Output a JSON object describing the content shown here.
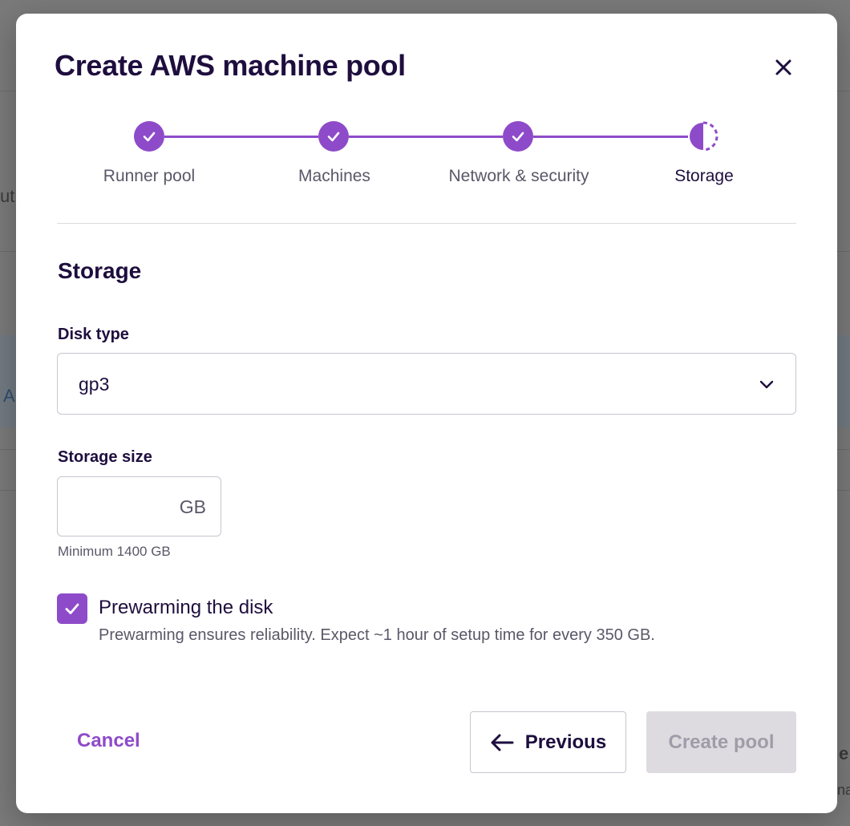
{
  "modal": {
    "title": "Create AWS machine pool",
    "close_icon": "close-icon"
  },
  "stepper": {
    "steps": [
      {
        "label": "Runner pool",
        "state": "complete"
      },
      {
        "label": "Machines",
        "state": "complete"
      },
      {
        "label": "Network & security",
        "state": "complete"
      },
      {
        "label": "Storage",
        "state": "current"
      }
    ]
  },
  "storage": {
    "section_title": "Storage",
    "disk_type_label": "Disk type",
    "disk_type_value": "gp3",
    "storage_size_label": "Storage size",
    "storage_size_value": "",
    "storage_size_unit": "GB",
    "storage_size_hint": "Minimum 1400 GB",
    "prewarm_checked": true,
    "prewarm_label": "Prewarming the disk",
    "prewarm_description": "Prewarming ensures reliability. Expect ~1 hour of setup time for every 350 GB."
  },
  "footer": {
    "cancel_label": "Cancel",
    "previous_label": "Previous",
    "create_label": "Create pool",
    "create_enabled": false
  },
  "background": {
    "frag_a": "ut",
    "frag_b": "A",
    "frag_c": "e",
    "frag_d": "na"
  },
  "colors": {
    "accent": "#8e4bc9",
    "text": "#1e0e3e",
    "muted": "#5b5768",
    "disabled_bg": "#dddbe0",
    "overlay": "#7a7a7a"
  }
}
